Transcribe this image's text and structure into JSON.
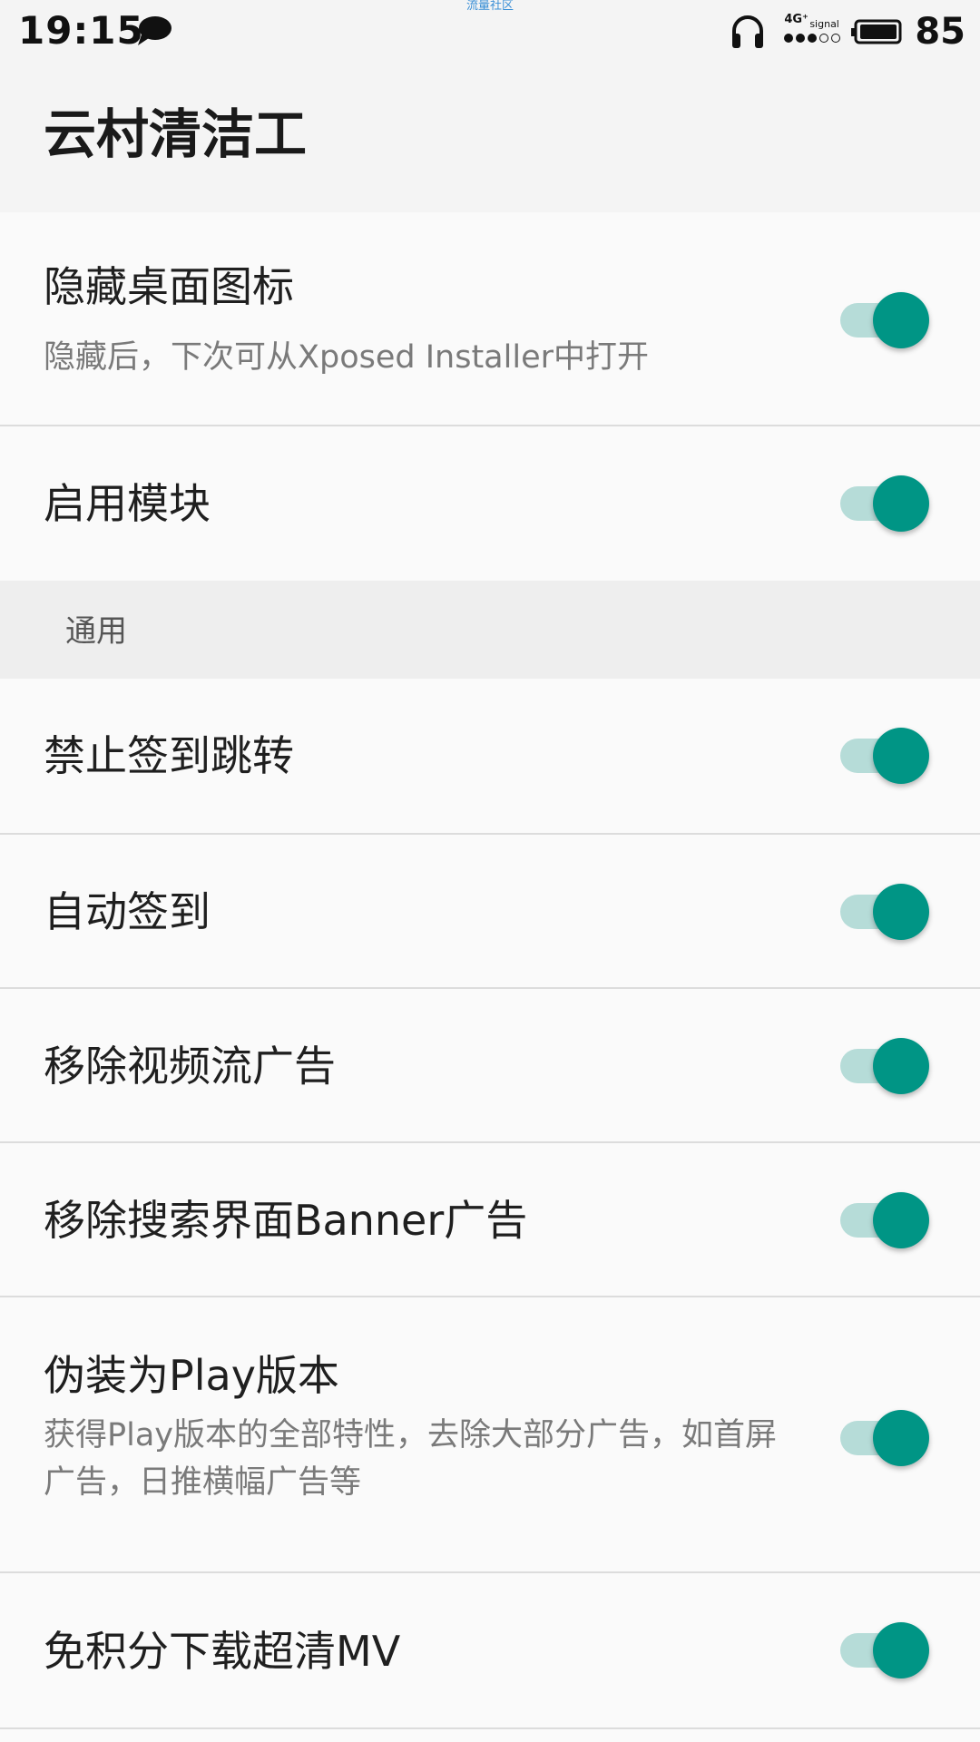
{
  "status_bar": {
    "time": "19:15",
    "watermark": "流量社区",
    "network": "4G⁺",
    "signal_label": "signal",
    "battery_level": "85",
    "icons": [
      "chat-bubble-icon",
      "headset-icon",
      "signal-icon",
      "battery-icon"
    ]
  },
  "app_bar": {
    "title": "云村清洁工"
  },
  "settings": {
    "hide_icon": {
      "title": "隐藏桌面图标",
      "summary": "隐藏后，下次可从Xposed Installer中打开",
      "enabled": true
    },
    "enable_module": {
      "title": "启用模块",
      "enabled": true
    },
    "general_section": {
      "label": "通用"
    },
    "items": [
      {
        "title": "禁止签到跳转",
        "enabled": true
      },
      {
        "title": "自动签到",
        "enabled": true
      },
      {
        "title": "移除视频流广告",
        "enabled": true
      },
      {
        "title": "移除搜索界面Banner广告",
        "enabled": true
      }
    ],
    "play_version": {
      "title": "伪装为Play版本",
      "summary": "获得Play版本的全部特性，去除大部分广告，如首屏广告，日推横幅广告等",
      "enabled": true
    },
    "download_mv": {
      "title": "免积分下载超清MV",
      "enabled": true
    }
  },
  "colors": {
    "accent": "#009585",
    "switch_track": "#b6dcd8",
    "background": "#fafafa",
    "section_background": "#eeeeee",
    "divider": "#dcdcdc"
  }
}
